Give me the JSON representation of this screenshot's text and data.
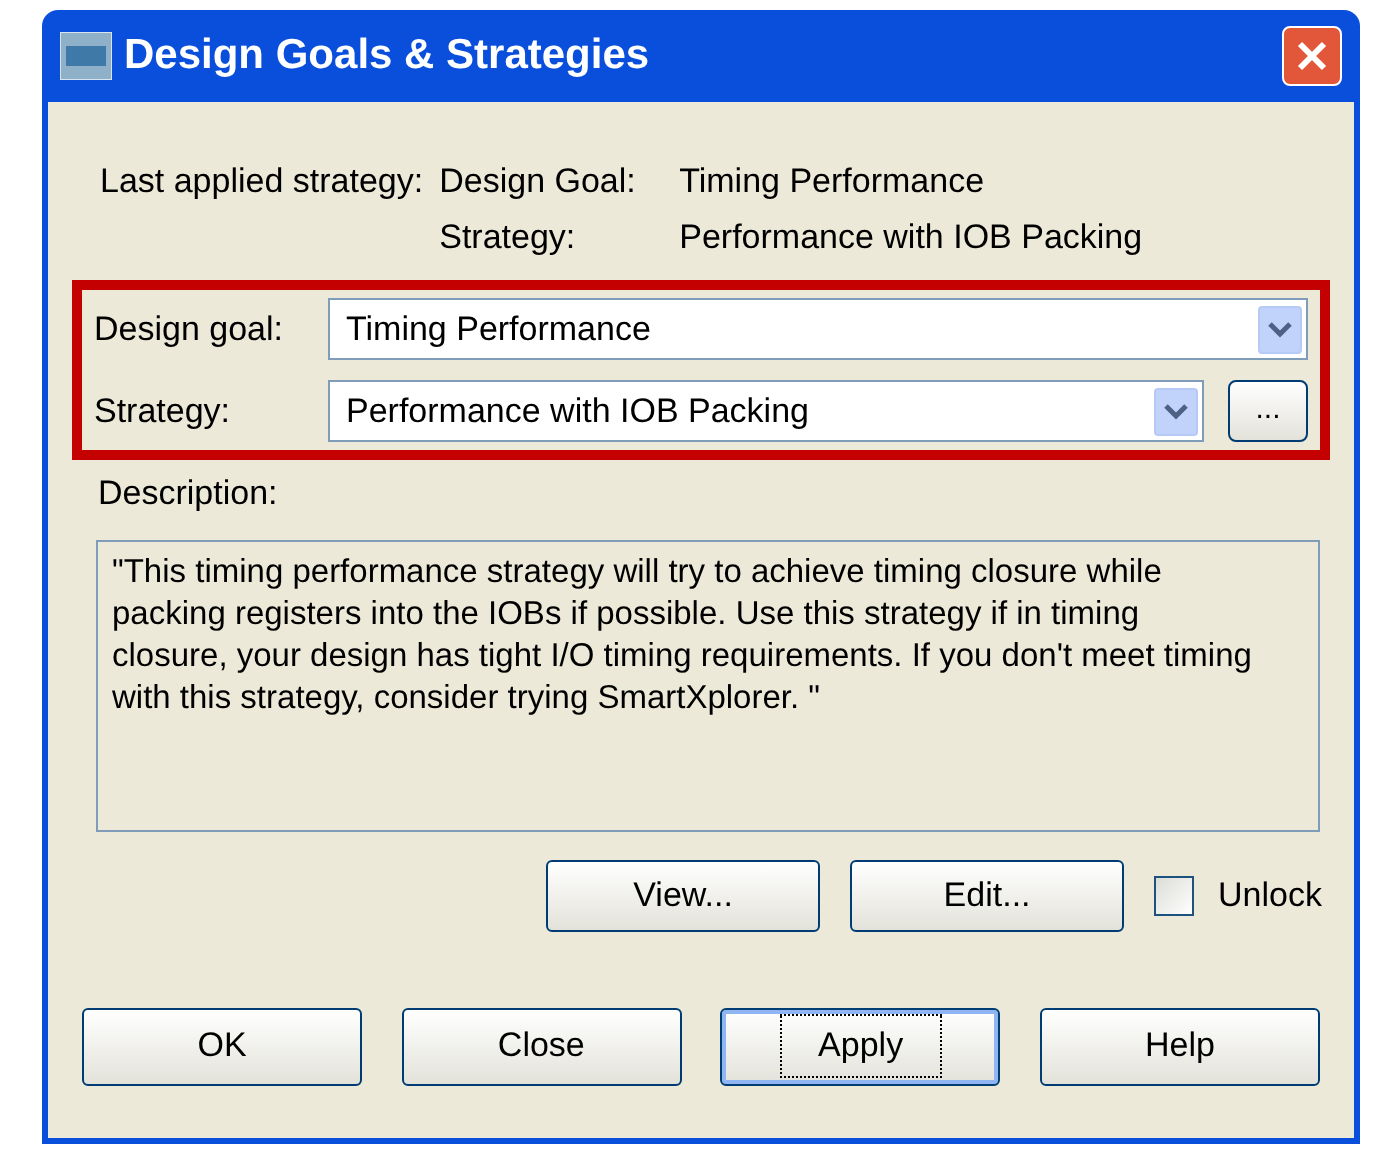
{
  "window": {
    "title": "Design Goals & Strategies"
  },
  "last_applied": {
    "label": "Last applied strategy:",
    "goal_label": "Design Goal:",
    "goal_value": "Timing Performance",
    "strategy_label": "Strategy:",
    "strategy_value": "Performance with IOB Packing"
  },
  "design_goal": {
    "label": "Design goal:",
    "value": "Timing Performance"
  },
  "strategy": {
    "label": "Strategy:",
    "value": "Performance with IOB Packing",
    "browse": "..."
  },
  "description": {
    "label": "Description:",
    "text": "\"This timing performance strategy will try to achieve timing closure while packing registers into the IOBs if possible.  Use this strategy if in timing closure, your design has tight I/O timing requirements.  If you don't meet timing with this strategy, consider trying SmartXplorer.  \""
  },
  "actions": [
    {
      "label": "View..."
    },
    {
      "label": "Edit..."
    }
  ],
  "unlock": {
    "label": "Unlock",
    "checked": false
  },
  "buttons": [
    {
      "label": "OK",
      "focused": false
    },
    {
      "label": "Close",
      "focused": false
    },
    {
      "label": "Apply",
      "focused": true
    },
    {
      "label": "Help",
      "focused": false
    }
  ]
}
